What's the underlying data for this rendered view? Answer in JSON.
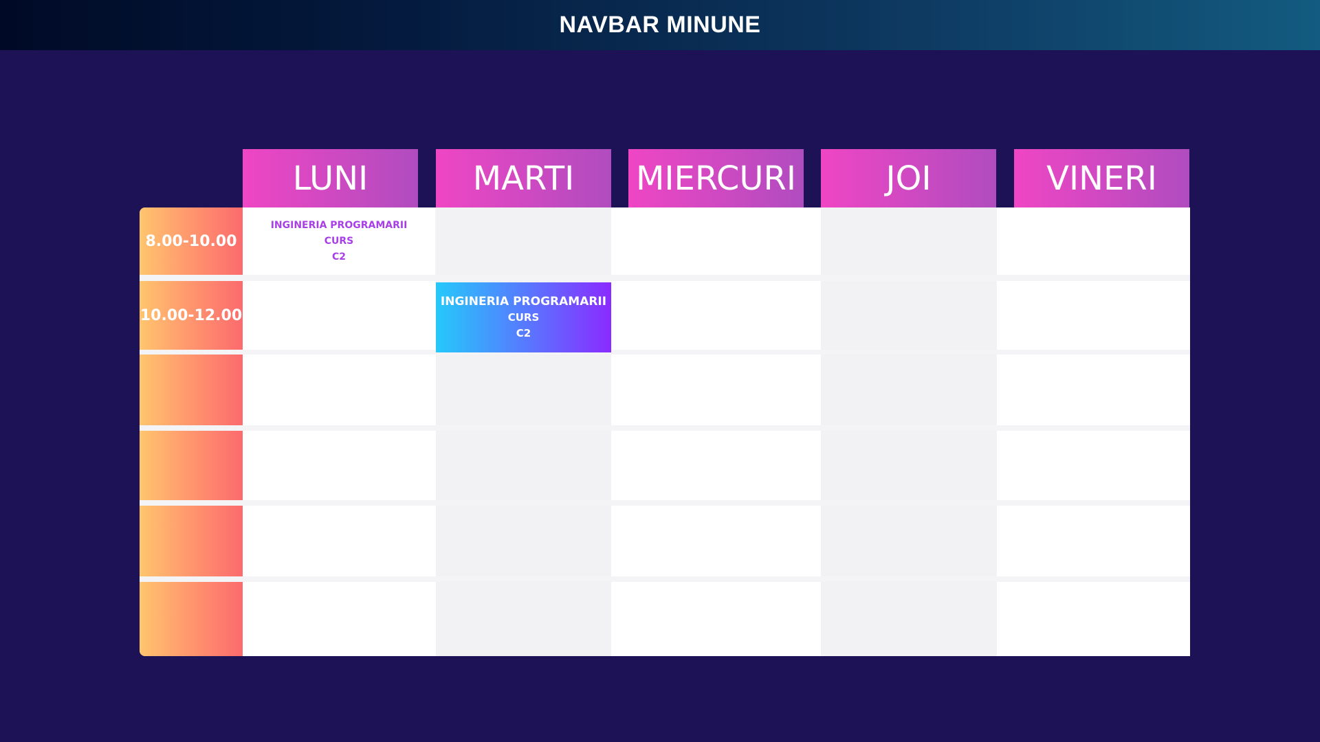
{
  "navbar": {
    "title": "NAVBAR MINUNE"
  },
  "days": [
    "LUNI",
    "MARTI",
    "MIERCURI",
    "JOI",
    "VINERI"
  ],
  "time_slots": [
    "8.00-10.00",
    "10.00-12.00",
    "",
    "",
    "",
    ""
  ],
  "events": {
    "luni_8": {
      "title": "INGINERIA PROGRAMARII",
      "type": "CURS",
      "room": "C2"
    },
    "marti_10": {
      "title": "INGINERIA PROGRAMARII",
      "type": "CURS",
      "room": "C2"
    }
  },
  "colors": {
    "background": "#1c1255",
    "day_header_start": "#ef46c4",
    "day_header_end": "#b04cbf",
    "time_start": "#ffc56e",
    "time_end": "#fc6a6d",
    "event_text": "#a93fe6",
    "highlight_start": "#25c9fb",
    "highlight_end": "#8a2bff"
  }
}
